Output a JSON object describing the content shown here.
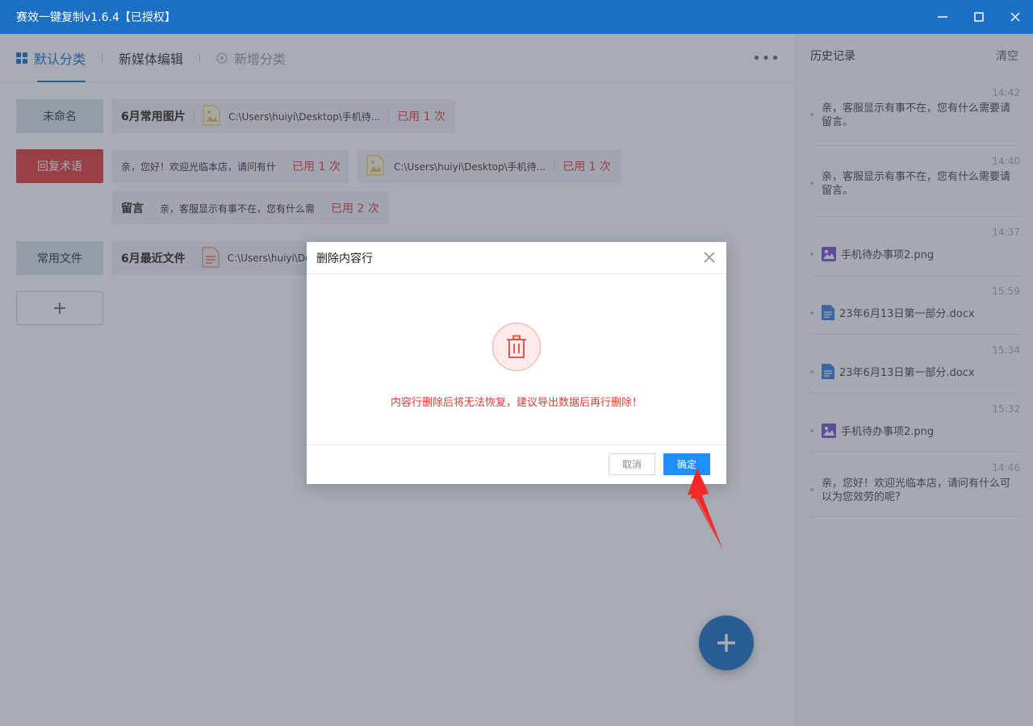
{
  "window": {
    "title": "赛效一键复制v1.6.4【已授权】"
  },
  "tabs": [
    {
      "label": "默认分类"
    },
    {
      "label": "新媒体编辑"
    },
    {
      "label": "新增分类"
    }
  ],
  "more_label": "•••",
  "categories": [
    {
      "label": "未命名"
    },
    {
      "label": "回复术语"
    },
    {
      "label": "常用文件"
    },
    {
      "label": "+"
    }
  ],
  "cards": [
    {
      "name": "6月常用图片",
      "path": "C:\\Users\\huiyi\\Desktop\\手机待...",
      "used": "已用 1 次"
    },
    {
      "name": "亲，您好！欢迎光临本店，请问有什",
      "used": "已用 1 次"
    },
    {
      "path": "C:\\Users\\huiyi\\Desktop\\手机待...",
      "used": "已用 1 次"
    },
    {
      "name": "留言",
      "text": "亲，客服显示有事不在，您有什么需",
      "used": "已用 2 次"
    },
    {
      "name": "6月最近文件",
      "path": "C:\\Users\\huiyi\\De"
    }
  ],
  "sidebar": {
    "title": "历史记录",
    "clear_label": "清空",
    "items": [
      {
        "time": "14:42",
        "text": "亲，客服显示有事不在，您有什么需要请留言。",
        "icon": "text"
      },
      {
        "time": "14:40",
        "text": "亲，客服显示有事不在，您有什么需要请留言。",
        "icon": "text"
      },
      {
        "time": "14:37",
        "text": "手机待办事项2.png",
        "icon": "image-icon"
      },
      {
        "time": "15:59",
        "text": "23年6月13日第一部分.docx",
        "icon": "document-icon"
      },
      {
        "time": "15:34",
        "text": "23年6月13日第一部分.docx",
        "icon": "document-icon"
      },
      {
        "time": "15:32",
        "text": "手机待办事项2.png",
        "icon": "image-icon"
      },
      {
        "time": "14:46",
        "text": "亲，您好！欢迎光临本店，请问有什么可以为您效劳的呢?",
        "icon": "text"
      }
    ]
  },
  "dialog": {
    "title": "删除内容行",
    "message": "内容行删除后将无法恢复，建议导出数据后再行删除！",
    "cancel_label": "取消",
    "ok_label": "确定"
  },
  "colors": {
    "brand": "#1b6fc4",
    "danger": "#e53935",
    "ok_button": "#1e90ff"
  }
}
